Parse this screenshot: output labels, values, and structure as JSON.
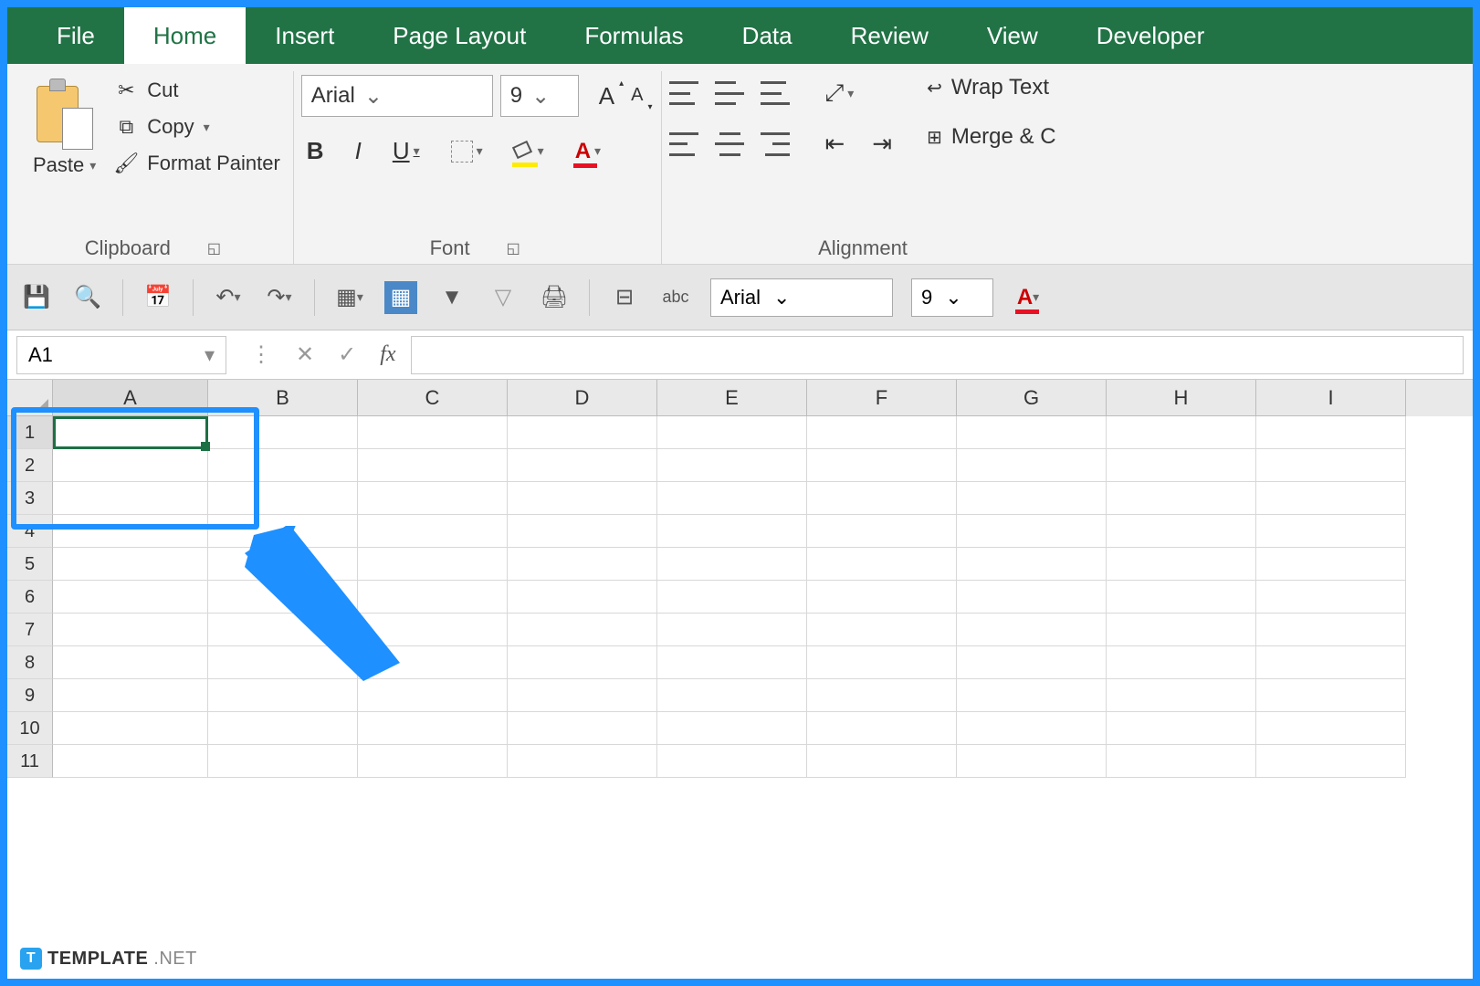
{
  "tabs": {
    "file": "File",
    "home": "Home",
    "insert": "Insert",
    "page_layout": "Page Layout",
    "formulas": "Formulas",
    "data": "Data",
    "review": "Review",
    "view": "View",
    "developer": "Developer"
  },
  "clipboard": {
    "paste": "Paste",
    "cut": "Cut",
    "copy": "Copy",
    "format_painter": "Format Painter",
    "group_label": "Clipboard"
  },
  "font": {
    "name": "Arial",
    "size": "9",
    "bold": "B",
    "italic": "I",
    "underline": "U",
    "grow": "A",
    "shrink": "A",
    "color_letter": "A",
    "group_label": "Font"
  },
  "alignment": {
    "wrap_text": "Wrap Text",
    "merge": "Merge & C",
    "group_label": "Alignment"
  },
  "qat": {
    "font": "Arial",
    "size": "9",
    "color_letter": "A"
  },
  "namebox": {
    "value": "A1"
  },
  "formula_bar": {
    "fx": "fx",
    "value": ""
  },
  "columns": [
    "A",
    "B",
    "C",
    "D",
    "E",
    "F",
    "G",
    "H",
    "I"
  ],
  "rows": [
    "1",
    "2",
    "3",
    "4",
    "5",
    "6",
    "7",
    "8",
    "9",
    "10",
    "11"
  ],
  "selected_cell": "A1",
  "watermark": {
    "badge": "T",
    "brand": "TEMPLATE",
    "suffix": ".NET"
  }
}
